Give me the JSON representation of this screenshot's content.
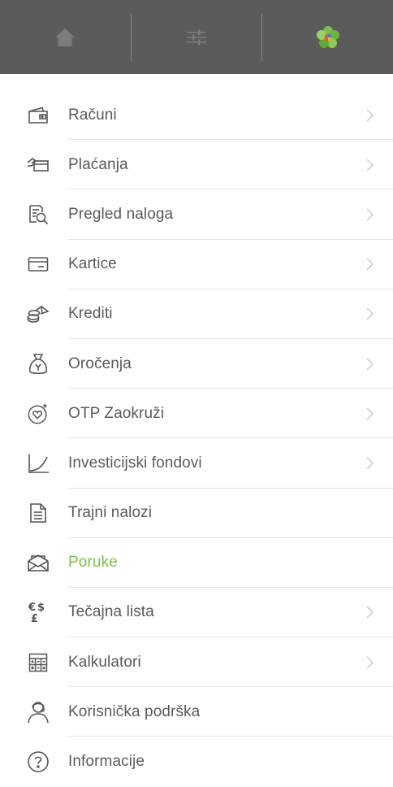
{
  "topbar": {
    "buttons": [
      {
        "icon": "home-icon"
      },
      {
        "icon": "settings-sliders-icon"
      },
      {
        "icon": "otp-logo-icon"
      }
    ]
  },
  "menu": {
    "items": [
      {
        "label": "Računi",
        "icon": "wallet-icon",
        "chevron": true
      },
      {
        "label": "Plaćanja",
        "icon": "payment-icon",
        "chevron": true
      },
      {
        "label": "Pregled naloga",
        "icon": "order-review-icon",
        "chevron": true
      },
      {
        "label": "Kartice",
        "icon": "card-icon",
        "chevron": true
      },
      {
        "label": "Krediti",
        "icon": "coins-icon",
        "chevron": true
      },
      {
        "label": "Oročenja",
        "icon": "money-bag-icon",
        "chevron": true
      },
      {
        "label": "OTP Zaokruži",
        "icon": "heart-plus-icon",
        "chevron": true
      },
      {
        "label": "Investicijski fondovi",
        "icon": "growth-curve-icon",
        "chevron": true
      },
      {
        "label": "Trajni nalozi",
        "icon": "document-icon",
        "chevron": false
      },
      {
        "label": "Poruke",
        "icon": "envelope-icon",
        "chevron": false,
        "active": true
      },
      {
        "label": "Tečajna lista",
        "icon": "currency-exchange-icon",
        "chevron": true
      },
      {
        "label": "Kalkulatori",
        "icon": "calculator-icon",
        "chevron": true
      },
      {
        "label": "Korisnička podrška",
        "icon": "support-agent-icon",
        "chevron": false
      },
      {
        "label": "Informacije",
        "icon": "question-circle-icon",
        "chevron": false
      }
    ]
  },
  "colors": {
    "topbar": "#5b5b5b",
    "text": "#5a5a5a",
    "active": "#7cc04b",
    "icon": "#555555",
    "chevron": "#cfcfcf"
  }
}
